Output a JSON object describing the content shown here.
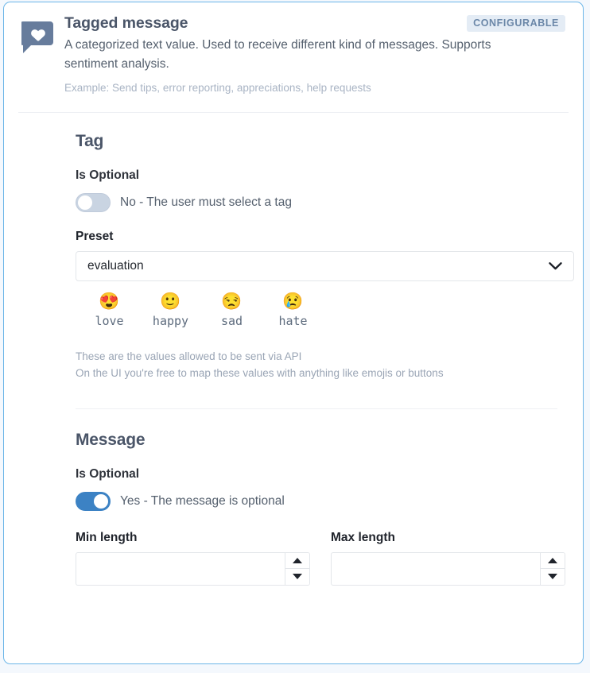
{
  "card": {
    "header": {
      "icon": "chat-bubble-heart-icon",
      "title": "Tagged message",
      "description": "A categorized text value. Used to receive different kind of messages. Supports sentiment analysis.",
      "example": "Example: Send tips, error reporting, appreciations, help requests",
      "badge": "CONFIGURABLE"
    },
    "tag_section": {
      "title": "Tag",
      "is_optional_label": "Is Optional",
      "toggle": {
        "state": "off",
        "text": "No - The user must select a tag"
      },
      "preset": {
        "label": "Preset",
        "value": "evaluation",
        "chevron_icon": "chevron-down-icon",
        "options": [
          "evaluation"
        ]
      },
      "values": [
        {
          "emoji": "😍",
          "emoji_name": "smiling-face-with-heart-eyes-emoji",
          "label": "love"
        },
        {
          "emoji": "🙂",
          "emoji_name": "slightly-smiling-face-emoji",
          "label": "happy"
        },
        {
          "emoji": "😒",
          "emoji_name": "unamused-face-emoji",
          "label": "sad"
        },
        {
          "emoji": "😢",
          "emoji_name": "crying-face-emoji",
          "label": "hate"
        }
      ],
      "helper_line_1": "These are the values allowed to be sent via API",
      "helper_line_2": "On the UI you're free to map these values with anything like emojis or buttons"
    },
    "message_section": {
      "title": "Message",
      "is_optional_label": "Is Optional",
      "toggle": {
        "state": "on",
        "text": "Yes - The message is optional"
      },
      "min_length": {
        "label": "Min length",
        "value": "",
        "placeholder": ""
      },
      "max_length": {
        "label": "Max length",
        "value": "",
        "placeholder": ""
      }
    }
  },
  "colors": {
    "card_border": "#6cb6e8",
    "page_background": "#f4f8fd",
    "badge_background": "#e4ecf5",
    "badge_text": "#6b87a8",
    "toggle_on": "#3c82c4",
    "toggle_off": "#c9d4e2",
    "icon": "#677c9c",
    "heading": "#4a5568",
    "muted_text": "#9aa5b5"
  }
}
